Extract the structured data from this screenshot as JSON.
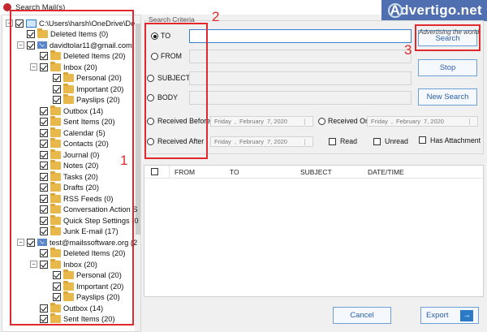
{
  "window": {
    "title": "Search Mail(s)"
  },
  "banner": {
    "text": "Advertigo.net",
    "tagline": "Advertising the world"
  },
  "tree": {
    "items": [
      {
        "label": "C:\\Users\\harsh\\OneDrive\\De",
        "level": 0,
        "kind": "monitor",
        "exp": "−"
      },
      {
        "label": "Deleted Items (0)",
        "level": 1,
        "kind": "folder"
      },
      {
        "label": "davidtolar11@gmail.com",
        "level": 1,
        "kind": "mail",
        "exp": "−"
      },
      {
        "label": "Deleted Items (20)",
        "level": 2,
        "kind": "folder"
      },
      {
        "label": "Inbox (20)",
        "level": 2,
        "kind": "folder",
        "exp": "−"
      },
      {
        "label": "Personal (20)",
        "level": 3,
        "kind": "folder"
      },
      {
        "label": "Important (20)",
        "level": 3,
        "kind": "folder"
      },
      {
        "label": "Payslips (20)",
        "level": 3,
        "kind": "folder"
      },
      {
        "label": "Outbox (14)",
        "level": 2,
        "kind": "folder"
      },
      {
        "label": "Sent Items (20)",
        "level": 2,
        "kind": "folder"
      },
      {
        "label": "Calendar (5)",
        "level": 2,
        "kind": "folder"
      },
      {
        "label": "Contacts (20)",
        "level": 2,
        "kind": "folder"
      },
      {
        "label": "Journal (0)",
        "level": 2,
        "kind": "folder"
      },
      {
        "label": "Notes (20)",
        "level": 2,
        "kind": "folder"
      },
      {
        "label": "Tasks (20)",
        "level": 2,
        "kind": "folder"
      },
      {
        "label": "Drafts (20)",
        "level": 2,
        "kind": "folder"
      },
      {
        "label": "RSS Feeds (0)",
        "level": 2,
        "kind": "folder"
      },
      {
        "label": "Conversation Action S",
        "level": 2,
        "kind": "folder"
      },
      {
        "label": "Quick Step Settings (0",
        "level": 2,
        "kind": "folder"
      },
      {
        "label": "Junk E-mail (17)",
        "level": 2,
        "kind": "folder"
      },
      {
        "label": "test@mailssoftware.org (2",
        "level": 1,
        "kind": "mail",
        "exp": "−"
      },
      {
        "label": "Deleted Items (20)",
        "level": 2,
        "kind": "folder"
      },
      {
        "label": "Inbox (20)",
        "level": 2,
        "kind": "folder",
        "exp": "−"
      },
      {
        "label": "Personal (20)",
        "level": 3,
        "kind": "folder"
      },
      {
        "label": "Important (20)",
        "level": 3,
        "kind": "folder"
      },
      {
        "label": "Payslips (20)",
        "level": 3,
        "kind": "folder"
      },
      {
        "label": "Outbox (14)",
        "level": 2,
        "kind": "folder"
      },
      {
        "label": "Sent Items (20)",
        "level": 2,
        "kind": "folder"
      }
    ]
  },
  "criteria": {
    "title": "Search Criteria",
    "to": "TO",
    "from": "FROM",
    "subject": "SUBJECT",
    "body": "BODY",
    "received_before": "Received Before",
    "received_on": "Received On",
    "received_after": "Received After",
    "date_value": {
      "day": "Friday",
      "month": "February",
      "date": "7, 2020"
    },
    "read": "Read",
    "unread": "Unread",
    "has_attachment": "Has Attachment"
  },
  "buttons": {
    "search": "Search",
    "stop": "Stop",
    "new_search": "New Search",
    "cancel": "Cancel",
    "export": "Export"
  },
  "results": {
    "columns": [
      "FROM",
      "TO",
      "SUBJECT",
      "DATE/TIME"
    ]
  },
  "annotations": {
    "one": "1",
    "two": "2",
    "three": "3"
  }
}
